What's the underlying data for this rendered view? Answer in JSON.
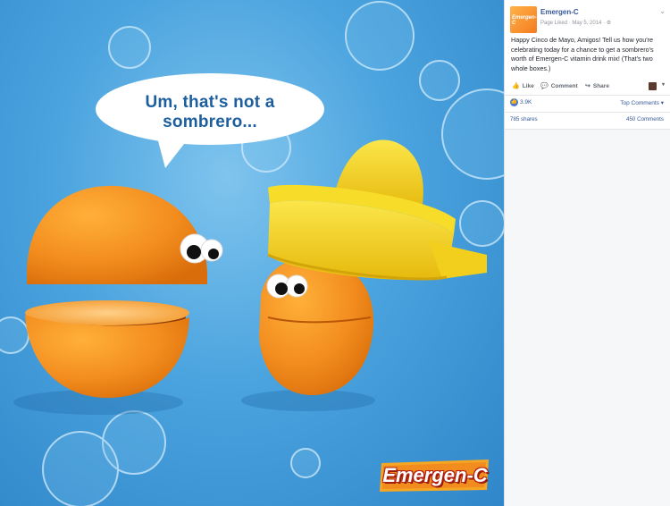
{
  "photo": {
    "speech": "Um, that's not a sombrero...",
    "logo_text": "Emergen-C"
  },
  "post": {
    "page_name": "Emergen-C",
    "meta": "Page Liked · May 5, 2014 · ⚙",
    "avatar_text": "Emergen-C",
    "body": "Happy Cinco de Mayo, Amigos! Tell us how you're celebrating today for a chance to get a sombrero's worth of Emergen-C vitamin drink mix! (That's two whole boxes.)",
    "actions": {
      "like": "Like",
      "comment": "Comment",
      "share": "Share"
    },
    "reactions_count": "3.9K",
    "top_comments": "Top Comments ▾",
    "shares": "785 shares",
    "comments": "450 Comments",
    "colors": {
      "link": "#365899",
      "sky": "#4aa3de",
      "orange": "#f28c1e",
      "juicer": "#f5d21f"
    }
  }
}
